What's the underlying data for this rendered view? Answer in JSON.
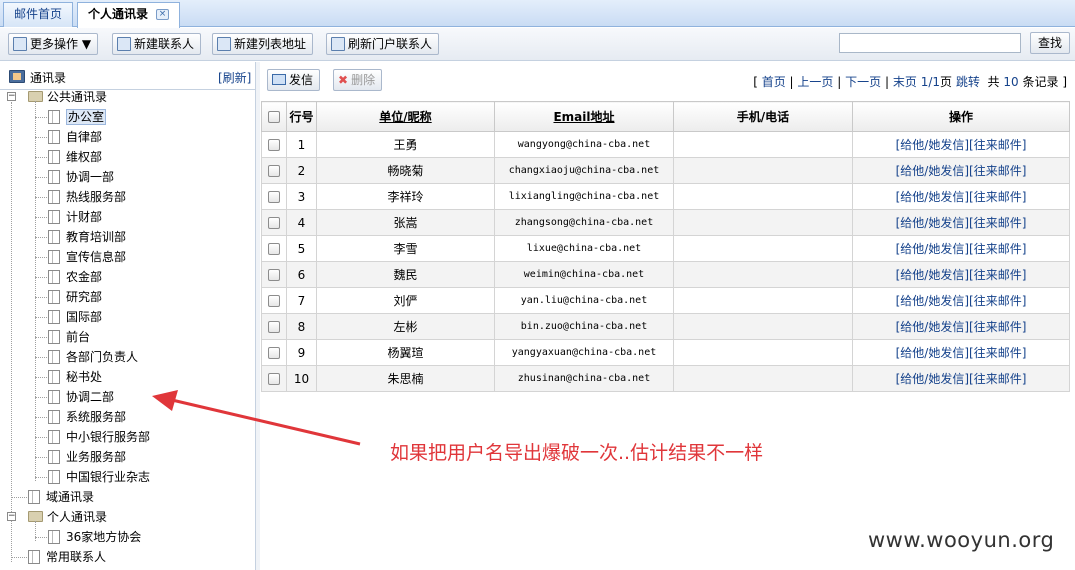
{
  "tabs": [
    {
      "label": "邮件首页"
    },
    {
      "label": "个人通讯录"
    }
  ],
  "tab_close_icon": "close-icon",
  "toolbar": {
    "more_actions": "更多操作",
    "new_contact": "新建联系人",
    "new_list": "新建列表地址",
    "refresh_portal": "刷新门户联系人",
    "search_value": "",
    "search_button": "查找"
  },
  "sidebar": {
    "title": "通讯录",
    "refresh": "[刷新]",
    "public": "公共通讯录",
    "items": [
      "办公室",
      "自律部",
      "维权部",
      "协调一部",
      "热线服务部",
      "计财部",
      "教育培训部",
      "宣传信息部",
      "农金部",
      "研究部",
      "国际部",
      "前台",
      "各部门负责人",
      "秘书处",
      "协调二部",
      "系统服务部",
      "中小银行服务部",
      "业务服务部",
      "中国银行业杂志"
    ],
    "domain": "域通讯录",
    "personal": "个人通讯录",
    "personal_items": [
      "36家地方协会"
    ],
    "frequent": "常用联系人"
  },
  "actions": {
    "send": "发信",
    "delete": "删除"
  },
  "pager": {
    "open": "[",
    "first": "首页",
    "prev": "上一页",
    "next": "下一页",
    "last": "末页",
    "page": "1/1",
    "page_suffix": "页",
    "jump": "跳转",
    "total_prefix": "共",
    "total": "10",
    "total_suffix": "条记录",
    "close": "]",
    "sep": "|"
  },
  "table": {
    "headers": [
      "行号",
      "单位/昵称",
      "Email地址",
      "手机/电话",
      "操作"
    ],
    "op_text": "[给他/她发信][往来邮件]",
    "rows": [
      {
        "no": "1",
        "name": "王勇",
        "email": "wangyong@china-cba.net",
        "phone": ""
      },
      {
        "no": "2",
        "name": "畅晓菊",
        "email": "changxiaoju@china-cba.net",
        "phone": ""
      },
      {
        "no": "3",
        "name": "李祥玲",
        "email": "lixiangling@china-cba.net",
        "phone": ""
      },
      {
        "no": "4",
        "name": "张嵩",
        "email": "zhangsong@china-cba.net",
        "phone": ""
      },
      {
        "no": "5",
        "name": "李雪",
        "email": "lixue@china-cba.net",
        "phone": ""
      },
      {
        "no": "6",
        "name": "魏民",
        "email": "weimin@china-cba.net",
        "phone": ""
      },
      {
        "no": "7",
        "name": "刘俨",
        "email": "yan.liu@china-cba.net",
        "phone": ""
      },
      {
        "no": "8",
        "name": "左彬",
        "email": "bin.zuo@china-cba.net",
        "phone": ""
      },
      {
        "no": "9",
        "name": "杨翼瑄",
        "email": "yangyaxuan@china-cba.net",
        "phone": ""
      },
      {
        "no": "10",
        "name": "朱思楠",
        "email": "zhusinan@china-cba.net",
        "phone": ""
      }
    ]
  },
  "annotation": "如果把用户名导出爆破一次..估计结果不一样",
  "watermark": "www.wooyun.org",
  "colors": {
    "annotation": "#e0363a",
    "link": "#15428b"
  }
}
